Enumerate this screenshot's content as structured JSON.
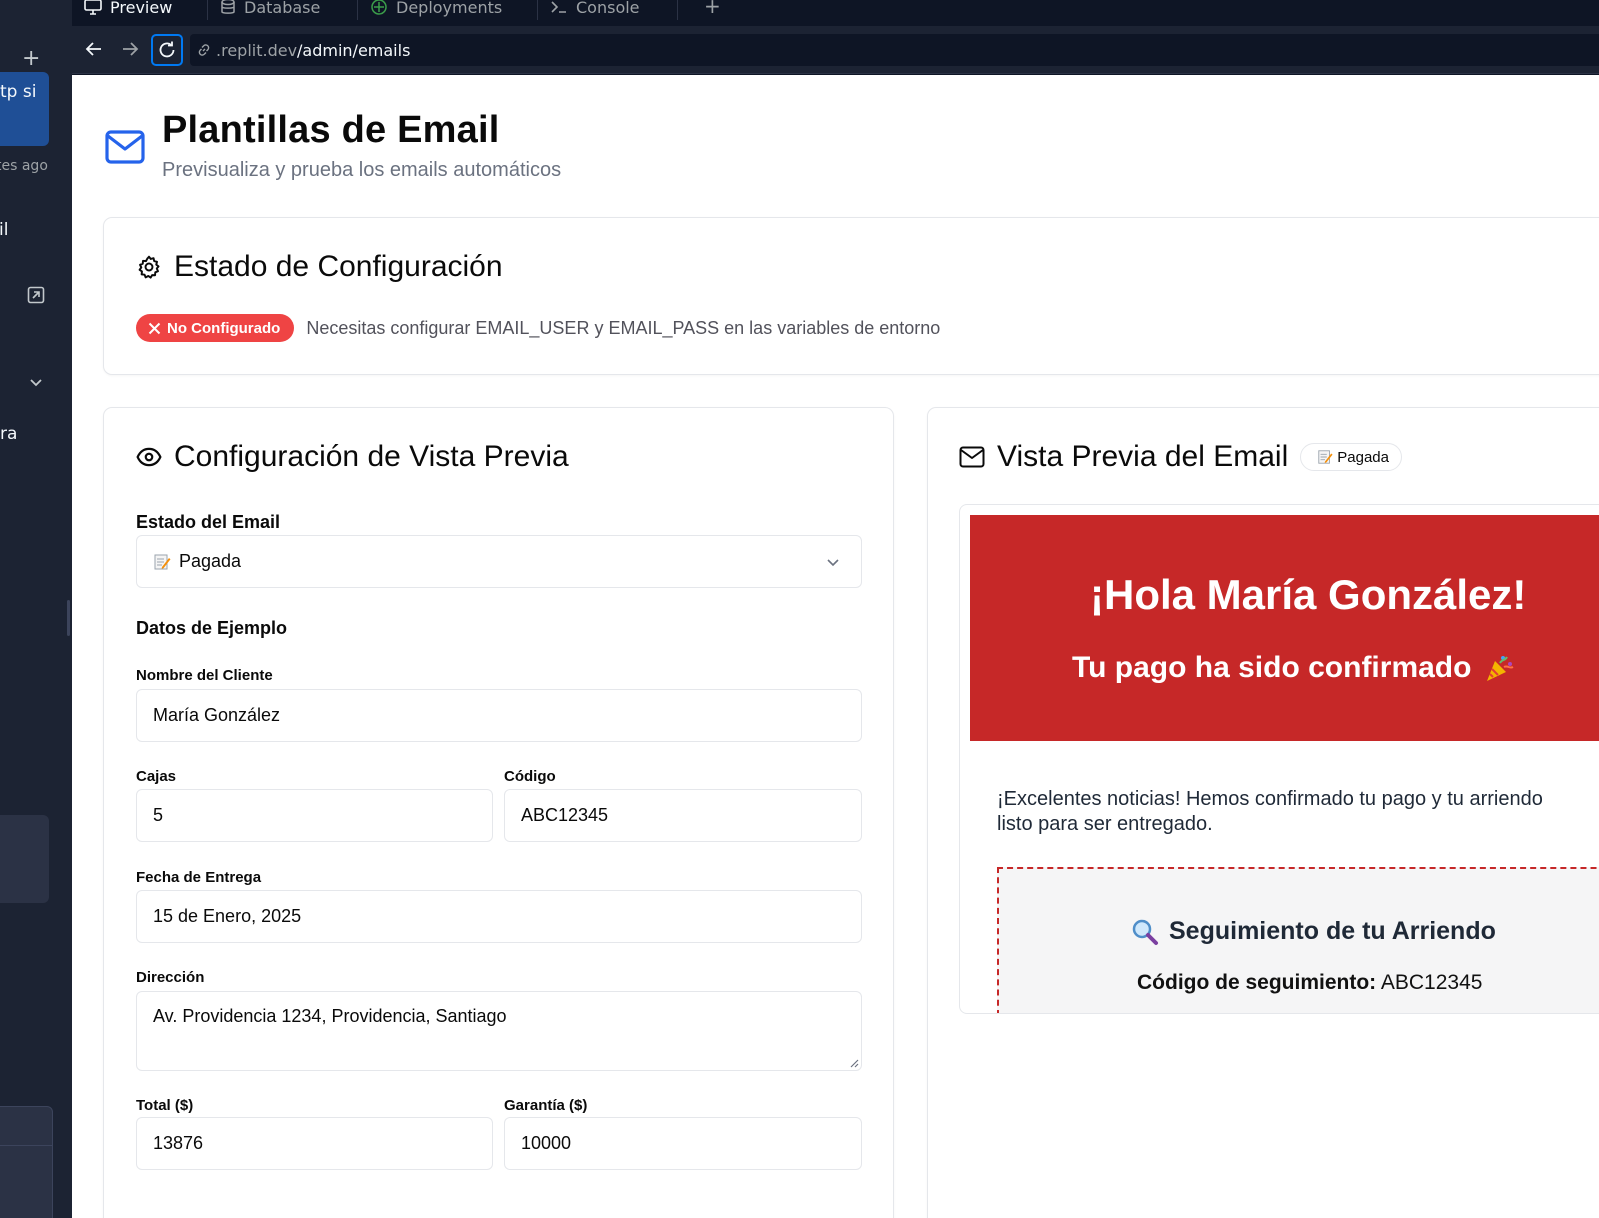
{
  "sidebar": {
    "add_symbol": "+",
    "item_text": "tp si",
    "timestamp": "tes ago",
    "text_il": "il",
    "text_ra": "ra"
  },
  "tabs": [
    {
      "label": "Preview",
      "icon": "monitor-icon"
    },
    {
      "label": "Database",
      "icon": "database-icon"
    },
    {
      "label": "Deployments",
      "icon": "deploy-icon"
    },
    {
      "label": "Console",
      "icon": "terminal-icon"
    }
  ],
  "tab_add": "+",
  "browser": {
    "url_domain": ".replit.dev",
    "url_path": "/admin/emails"
  },
  "page": {
    "title": "Plantillas de Email",
    "subtitle": "Previsualiza y prueba los emails automáticos"
  },
  "config_status": {
    "title": "Estado de Configuración",
    "badge": "No Configurado",
    "message": "Necesitas configurar EMAIL_USER y EMAIL_PASS en las variables de entorno"
  },
  "form": {
    "title": "Configuración de Vista Previa",
    "estado_label": "Estado del Email",
    "estado_value": "Pagada",
    "section_label": "Datos de Ejemplo",
    "nombre_label": "Nombre del Cliente",
    "nombre_value": "María González",
    "cajas_label": "Cajas",
    "cajas_value": "5",
    "codigo_label": "Código",
    "codigo_value": "ABC12345",
    "fecha_label": "Fecha de Entrega",
    "fecha_value": "15 de Enero, 2025",
    "direccion_label": "Dirección",
    "direccion_value": "Av. Providencia 1234, Providencia, Santiago",
    "total_label": "Total ($)",
    "total_value": "13876",
    "garantia_label": "Garantía ($)",
    "garantia_value": "10000"
  },
  "preview": {
    "title": "Vista Previa del Email",
    "badge": "Pagada",
    "greeting": "¡Hola María González!",
    "subheading": "Tu pago ha sido confirmado",
    "body_line1": "¡Excelentes noticias! Hemos confirmado tu pago y tu arriendo",
    "body_line2": "listo para ser entregado.",
    "tracking_title": "Seguimiento de tu Arriendo",
    "tracking_code_label": "Código de seguimiento:",
    "tracking_code_value": "ABC12345"
  },
  "colors": {
    "accent": "#2563eb",
    "danger": "#ef4444",
    "email_brand": "#c62828",
    "ide_bg": "#0e1525"
  }
}
